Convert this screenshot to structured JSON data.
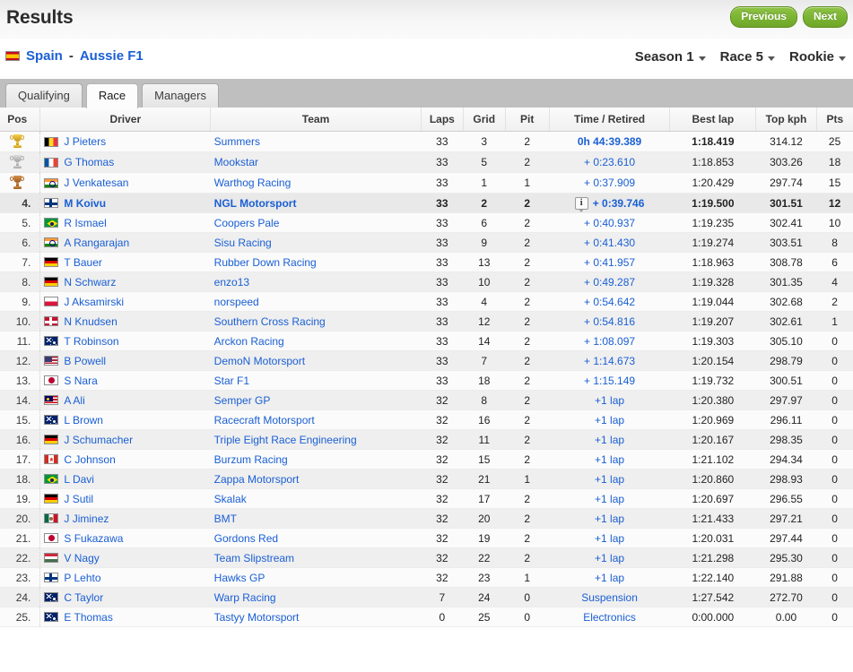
{
  "header": {
    "title": "Results",
    "previous_label": "Previous",
    "next_label": "Next",
    "accent_green": "#7cb433",
    "link_blue": "#1a5fd4"
  },
  "race_header": {
    "country_flag": "f-es",
    "country": "Spain",
    "separator": "-",
    "series": "Aussie F1",
    "selectors": [
      {
        "label": "Season 1",
        "name": "season-selector"
      },
      {
        "label": "Race 5",
        "name": "race-selector"
      },
      {
        "label": "Rookie",
        "name": "tier-selector"
      }
    ]
  },
  "tabs": [
    {
      "label": "Qualifying",
      "active": false
    },
    {
      "label": "Race",
      "active": true
    },
    {
      "label": "Managers",
      "active": false
    }
  ],
  "table": {
    "columns": [
      "Pos",
      "Driver",
      "Team",
      "Laps",
      "Grid",
      "Pit",
      "Time / Retired",
      "Best lap",
      "Top kph",
      "Pts"
    ],
    "rows": [
      {
        "pos": "",
        "medal": "gold",
        "flag": "f-be",
        "driver": "J Pieters",
        "team": "Summers",
        "laps": "33",
        "grid": "3",
        "pit": "2",
        "time": "0h 44:39.389",
        "time_leader": true,
        "info": false,
        "best": "1:18.419",
        "best_fastest": true,
        "kph": "314.12",
        "pts": "25",
        "highlight": false
      },
      {
        "pos": "",
        "medal": "silver",
        "flag": "f-fr",
        "driver": "G Thomas",
        "team": "Mookstar",
        "laps": "33",
        "grid": "5",
        "pit": "2",
        "time": "+ 0:23.610",
        "time_leader": false,
        "info": false,
        "best": "1:18.853",
        "best_fastest": false,
        "kph": "303.26",
        "pts": "18",
        "highlight": false
      },
      {
        "pos": "",
        "medal": "bronze",
        "flag": "f-in",
        "driver": "J Venkatesan",
        "team": "Warthog Racing",
        "laps": "33",
        "grid": "1",
        "pit": "1",
        "time": "+ 0:37.909",
        "time_leader": false,
        "info": false,
        "best": "1:20.429",
        "best_fastest": false,
        "kph": "297.74",
        "pts": "15",
        "highlight": false
      },
      {
        "pos": "4.",
        "medal": "",
        "flag": "f-fi",
        "driver": "M Koivu",
        "team": "NGL Motorsport",
        "laps": "33",
        "grid": "2",
        "pit": "2",
        "time": "+ 0:39.746",
        "time_leader": false,
        "info": true,
        "best": "1:19.500",
        "best_fastest": false,
        "kph": "301.51",
        "pts": "12",
        "highlight": true
      },
      {
        "pos": "5.",
        "medal": "",
        "flag": "f-br",
        "driver": "R Ismael",
        "team": "Coopers Pale",
        "laps": "33",
        "grid": "6",
        "pit": "2",
        "time": "+ 0:40.937",
        "time_leader": false,
        "info": false,
        "best": "1:19.235",
        "best_fastest": false,
        "kph": "302.41",
        "pts": "10",
        "highlight": false
      },
      {
        "pos": "6.",
        "medal": "",
        "flag": "f-in",
        "driver": "A Rangarajan",
        "team": "Sisu Racing",
        "laps": "33",
        "grid": "9",
        "pit": "2",
        "time": "+ 0:41.430",
        "time_leader": false,
        "info": false,
        "best": "1:19.274",
        "best_fastest": false,
        "kph": "303.51",
        "pts": "8",
        "highlight": false
      },
      {
        "pos": "7.",
        "medal": "",
        "flag": "f-de",
        "driver": "T Bauer",
        "team": "Rubber Down Racing",
        "laps": "33",
        "grid": "13",
        "pit": "2",
        "time": "+ 0:41.957",
        "time_leader": false,
        "info": false,
        "best": "1:18.963",
        "best_fastest": false,
        "kph": "308.78",
        "pts": "6",
        "highlight": false
      },
      {
        "pos": "8.",
        "medal": "",
        "flag": "f-de",
        "driver": "N Schwarz",
        "team": "enzo13",
        "laps": "33",
        "grid": "10",
        "pit": "2",
        "time": "+ 0:49.287",
        "time_leader": false,
        "info": false,
        "best": "1:19.328",
        "best_fastest": false,
        "kph": "301.35",
        "pts": "4",
        "highlight": false
      },
      {
        "pos": "9.",
        "medal": "",
        "flag": "f-pl",
        "driver": "J Aksamirski",
        "team": "norspeed",
        "laps": "33",
        "grid": "4",
        "pit": "2",
        "time": "+ 0:54.642",
        "time_leader": false,
        "info": false,
        "best": "1:19.044",
        "best_fastest": false,
        "kph": "302.68",
        "pts": "2",
        "highlight": false
      },
      {
        "pos": "10.",
        "medal": "",
        "flag": "f-dk",
        "driver": "N Knudsen",
        "team": "Southern Cross Racing",
        "laps": "33",
        "grid": "12",
        "pit": "2",
        "time": "+ 0:54.816",
        "time_leader": false,
        "info": false,
        "best": "1:19.207",
        "best_fastest": false,
        "kph": "302.61",
        "pts": "1",
        "highlight": false
      },
      {
        "pos": "11.",
        "medal": "",
        "flag": "f-au",
        "driver": "T Robinson",
        "team": "Arckon Racing",
        "laps": "33",
        "grid": "14",
        "pit": "2",
        "time": "+ 1:08.097",
        "time_leader": false,
        "info": false,
        "best": "1:19.303",
        "best_fastest": false,
        "kph": "305.10",
        "pts": "0",
        "highlight": false
      },
      {
        "pos": "12.",
        "medal": "",
        "flag": "f-us",
        "driver": "B Powell",
        "team": "DemoN Motorsport",
        "laps": "33",
        "grid": "7",
        "pit": "2",
        "time": "+ 1:14.673",
        "time_leader": false,
        "info": false,
        "best": "1:20.154",
        "best_fastest": false,
        "kph": "298.79",
        "pts": "0",
        "highlight": false
      },
      {
        "pos": "13.",
        "medal": "",
        "flag": "f-jp",
        "driver": "S Nara",
        "team": "Star F1",
        "laps": "33",
        "grid": "18",
        "pit": "2",
        "time": "+ 1:15.149",
        "time_leader": false,
        "info": false,
        "best": "1:19.732",
        "best_fastest": false,
        "kph": "300.51",
        "pts": "0",
        "highlight": false
      },
      {
        "pos": "14.",
        "medal": "",
        "flag": "f-my",
        "driver": "A Ali",
        "team": "Semper GP",
        "laps": "32",
        "grid": "8",
        "pit": "2",
        "time": "+1 lap",
        "time_leader": false,
        "info": false,
        "best": "1:20.380",
        "best_fastest": false,
        "kph": "297.97",
        "pts": "0",
        "highlight": false
      },
      {
        "pos": "15.",
        "medal": "",
        "flag": "f-au",
        "driver": "L Brown",
        "team": "Racecraft Motorsport",
        "laps": "32",
        "grid": "16",
        "pit": "2",
        "time": "+1 lap",
        "time_leader": false,
        "info": false,
        "best": "1:20.969",
        "best_fastest": false,
        "kph": "296.11",
        "pts": "0",
        "highlight": false
      },
      {
        "pos": "16.",
        "medal": "",
        "flag": "f-de",
        "driver": "J Schumacher",
        "team": "Triple Eight Race Engineering",
        "laps": "32",
        "grid": "11",
        "pit": "2",
        "time": "+1 lap",
        "time_leader": false,
        "info": false,
        "best": "1:20.167",
        "best_fastest": false,
        "kph": "298.35",
        "pts": "0",
        "highlight": false
      },
      {
        "pos": "17.",
        "medal": "",
        "flag": "f-ca",
        "driver": "C Johnson",
        "team": "Burzum Racing",
        "laps": "32",
        "grid": "15",
        "pit": "2",
        "time": "+1 lap",
        "time_leader": false,
        "info": false,
        "best": "1:21.102",
        "best_fastest": false,
        "kph": "294.34",
        "pts": "0",
        "highlight": false
      },
      {
        "pos": "18.",
        "medal": "",
        "flag": "f-br",
        "driver": "L Davi",
        "team": "Zappa Motorsport",
        "laps": "32",
        "grid": "21",
        "pit": "1",
        "time": "+1 lap",
        "time_leader": false,
        "info": false,
        "best": "1:20.860",
        "best_fastest": false,
        "kph": "298.93",
        "pts": "0",
        "highlight": false
      },
      {
        "pos": "19.",
        "medal": "",
        "flag": "f-de",
        "driver": "J Sutil",
        "team": "Skalak",
        "laps": "32",
        "grid": "17",
        "pit": "2",
        "time": "+1 lap",
        "time_leader": false,
        "info": false,
        "best": "1:20.697",
        "best_fastest": false,
        "kph": "296.55",
        "pts": "0",
        "highlight": false
      },
      {
        "pos": "20.",
        "medal": "",
        "flag": "f-mx",
        "driver": "J Jiminez",
        "team": "BMT",
        "laps": "32",
        "grid": "20",
        "pit": "2",
        "time": "+1 lap",
        "time_leader": false,
        "info": false,
        "best": "1:21.433",
        "best_fastest": false,
        "kph": "297.21",
        "pts": "0",
        "highlight": false
      },
      {
        "pos": "21.",
        "medal": "",
        "flag": "f-jp",
        "driver": "S Fukazawa",
        "team": "Gordons Red",
        "laps": "32",
        "grid": "19",
        "pit": "2",
        "time": "+1 lap",
        "time_leader": false,
        "info": false,
        "best": "1:20.031",
        "best_fastest": false,
        "kph": "297.44",
        "pts": "0",
        "highlight": false
      },
      {
        "pos": "22.",
        "medal": "",
        "flag": "f-hu",
        "driver": "V Nagy",
        "team": "Team Slipstream",
        "laps": "32",
        "grid": "22",
        "pit": "2",
        "time": "+1 lap",
        "time_leader": false,
        "info": false,
        "best": "1:21.298",
        "best_fastest": false,
        "kph": "295.30",
        "pts": "0",
        "highlight": false
      },
      {
        "pos": "23.",
        "medal": "",
        "flag": "f-fi",
        "driver": "P Lehto",
        "team": "Hawks GP",
        "laps": "32",
        "grid": "23",
        "pit": "1",
        "time": "+1 lap",
        "time_leader": false,
        "info": false,
        "best": "1:22.140",
        "best_fastest": false,
        "kph": "291.88",
        "pts": "0",
        "highlight": false
      },
      {
        "pos": "24.",
        "medal": "",
        "flag": "f-au",
        "driver": "C Taylor",
        "team": "Warp Racing",
        "laps": "7",
        "grid": "24",
        "pit": "0",
        "time": "Suspension",
        "time_leader": false,
        "info": false,
        "best": "1:27.542",
        "best_fastest": false,
        "kph": "272.70",
        "pts": "0",
        "highlight": false
      },
      {
        "pos": "25.",
        "medal": "",
        "flag": "f-au",
        "driver": "E Thomas",
        "team": "Tastyy Motorsport",
        "laps": "0",
        "grid": "25",
        "pit": "0",
        "time": "Electronics",
        "time_leader": false,
        "info": false,
        "best": "0:00.000",
        "best_fastest": false,
        "kph": "0.00",
        "pts": "0",
        "highlight": false
      }
    ]
  }
}
